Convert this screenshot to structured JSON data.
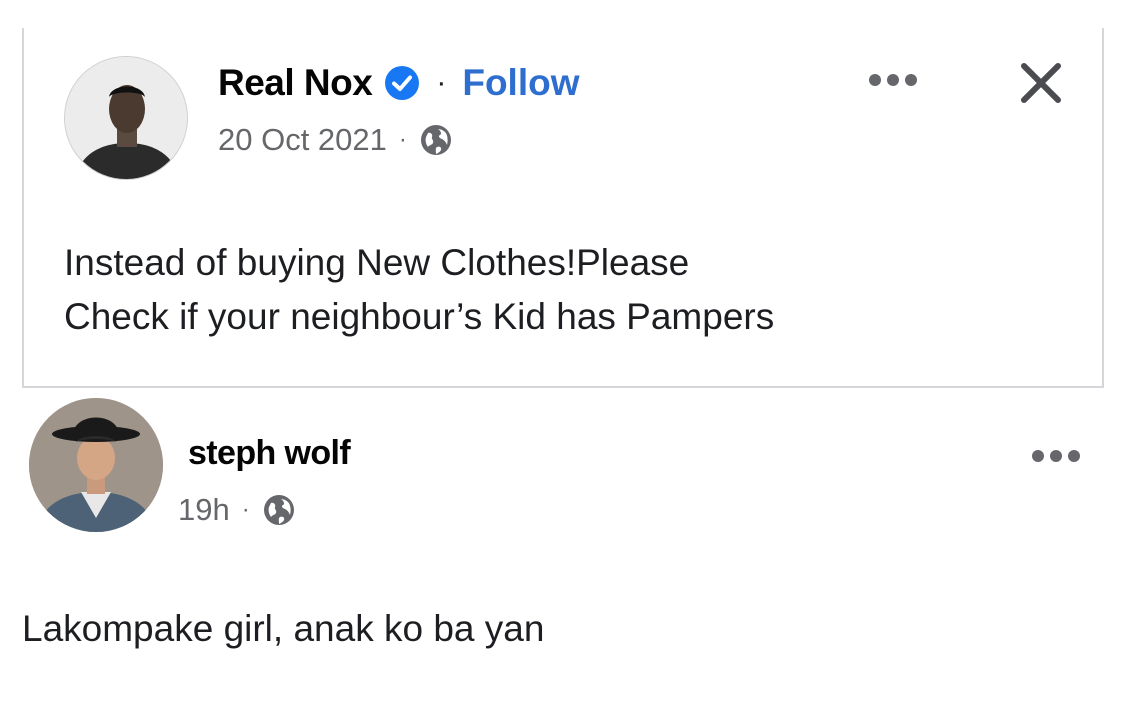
{
  "shared_post": {
    "author_name": "Real Nox",
    "separator": "·",
    "follow_label": "Follow",
    "date": "20 Oct 2021",
    "text_line1": "Instead of buying  New Clothes!Please",
    "text_line2": "Check if your neighbour’s Kid has Pampers",
    "verified_color": "#1877f2",
    "follow_color": "#2d6ecf"
  },
  "comment": {
    "author_name": "steph wolf",
    "time": "19h",
    "separator": "·",
    "text": "Lakompake girl, anak ko ba yan"
  },
  "icons": {
    "verified": "verified-badge-icon",
    "globe": "globe-icon",
    "more": "more-options-icon",
    "close": "close-icon"
  }
}
